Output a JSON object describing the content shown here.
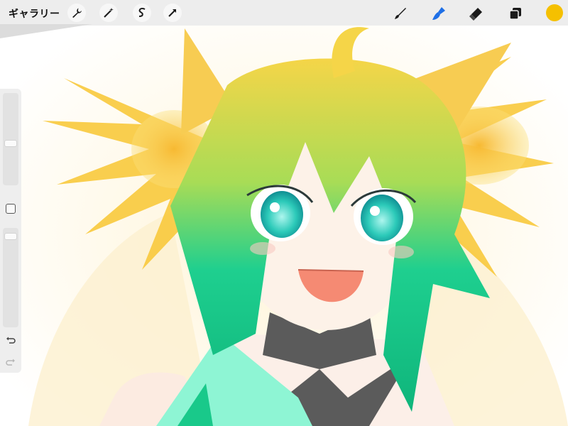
{
  "toolbar": {
    "gallery_label": "ギャラリー",
    "left_tools": [
      "wrench-icon",
      "magic-wand-icon",
      "selection-s-icon",
      "move-arrow-icon"
    ],
    "right_tools": [
      "brush-icon",
      "smudge-icon",
      "eraser-icon",
      "layers-icon"
    ],
    "active_tool": "smudge-icon",
    "color": "#f5c000",
    "accent": "#1e6fe6"
  },
  "sidebar": {
    "brush_size_level": 0.55,
    "opacity_level": 0.05,
    "buttons": [
      "modify-square-icon",
      "undo-icon",
      "redo-icon"
    ]
  },
  "canvas": {
    "colors": {
      "hair_yellow": "#f7c84a",
      "hair_green": "#14c88c",
      "eyes": "#3ed6c8",
      "mouth": "#f58a73",
      "collar": "#5b5b5b",
      "cloth": "#8ef5d4"
    }
  }
}
